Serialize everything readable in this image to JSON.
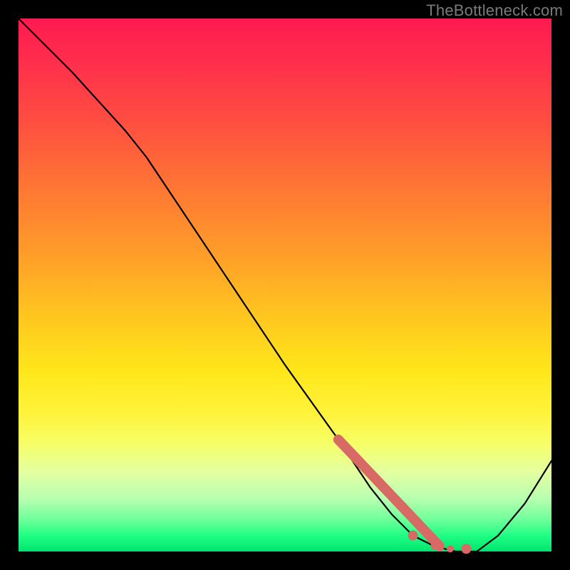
{
  "watermark": "TheBottleneck.com",
  "chart_data": {
    "type": "line",
    "title": "",
    "xlabel": "",
    "ylabel": "",
    "xlim": [
      0,
      100
    ],
    "ylim": [
      0,
      100
    ],
    "grid": false,
    "series": [
      {
        "name": "curve",
        "x": [
          0,
          10,
          20,
          24,
          30,
          40,
          50,
          60,
          66,
          70,
          74,
          78,
          82,
          86,
          90,
          95,
          100
        ],
        "y": [
          100,
          90,
          79,
          74,
          65,
          50,
          35,
          21,
          12,
          7,
          3,
          1,
          0,
          0,
          3,
          9,
          17
        ]
      }
    ],
    "highlight_segment": {
      "name": "dotted-indicator",
      "x": [
        60,
        66,
        70,
        73,
        76,
        79,
        82
      ],
      "y": [
        21,
        12,
        7,
        4,
        2,
        1,
        0
      ]
    },
    "flat_dots": {
      "x": [
        74,
        78,
        81,
        84
      ],
      "y": [
        3,
        1,
        0.5,
        0.5
      ]
    }
  }
}
